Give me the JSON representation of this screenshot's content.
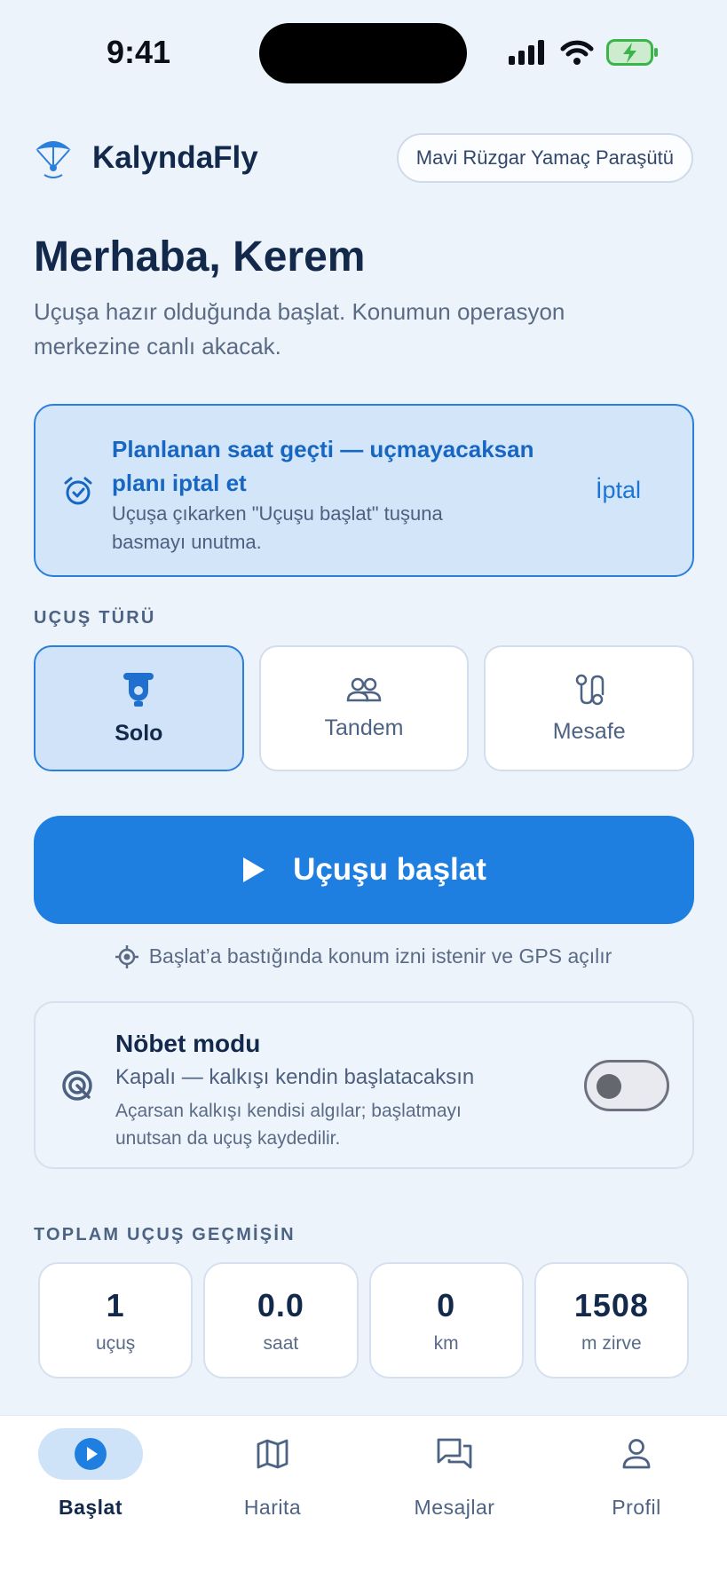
{
  "status_bar": {
    "time": "9:41"
  },
  "header": {
    "app_name": "KalyndaFly",
    "club_name": "Mavi Rüzgar Yamaç Paraşütü"
  },
  "greeting": "Merhaba, Kerem",
  "subtitle": "Uçuşa hazır olduğunda başlat. Konumun operasyon merkezine canlı akacak.",
  "alert": {
    "title": "Planlanan saat geçti — uçmayacaksan planı iptal et",
    "body": "Uçuşa çıkarken \"Uçuşu başlat\" tuşuna basmayı unutma.",
    "cancel_label": "İptal"
  },
  "flight_type": {
    "section_label": "UÇUŞ TÜRÜ",
    "options": [
      {
        "label": "Solo",
        "icon": "paraglider-harness-icon",
        "selected": true
      },
      {
        "label": "Tandem",
        "icon": "two-people-icon",
        "selected": false
      },
      {
        "label": "Mesafe",
        "icon": "route-icon",
        "selected": false
      }
    ]
  },
  "start_button": {
    "label": "Uçuşu başlat"
  },
  "gps_hint": "Başlat’a bastığında konum izni istenir ve GPS açılır",
  "guard_mode": {
    "title": "Nöbet modu",
    "status": "Kapalı — kalkışı kendin başlatacaksın",
    "description": "Açarsan kalkışı kendisi algılar; başlatmayı unutsan da uçuş kaydedilir.",
    "enabled": false
  },
  "stats": {
    "section_label": "TOPLAM UÇUŞ GEÇMİŞİN",
    "items": [
      {
        "value": "1",
        "unit": "uçuş"
      },
      {
        "value": "0.0",
        "unit": "saat"
      },
      {
        "value": "0",
        "unit": "km"
      },
      {
        "value": "1508",
        "unit": "m zirve"
      }
    ]
  },
  "tabs": [
    {
      "label": "Başlat",
      "icon": "play-icon",
      "active": true
    },
    {
      "label": "Harita",
      "icon": "map-icon",
      "active": false
    },
    {
      "label": "Mesajlar",
      "icon": "messages-icon",
      "active": false
    },
    {
      "label": "Profil",
      "icon": "profile-icon",
      "active": false
    }
  ],
  "colors": {
    "accent": "#1f7fe0",
    "background": "#edf3fb",
    "text": "#13294b"
  }
}
